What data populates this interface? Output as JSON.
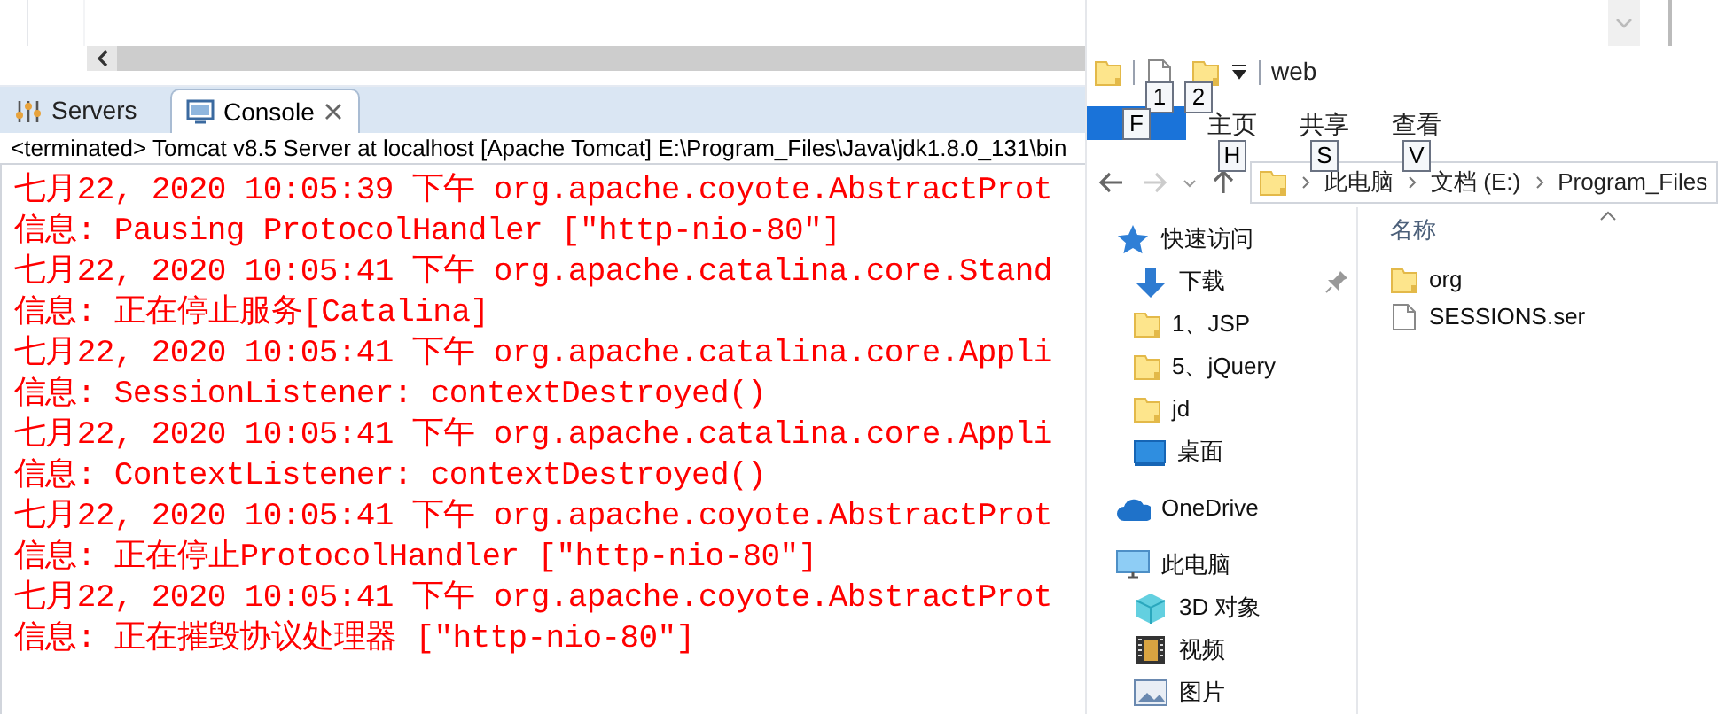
{
  "console_view": {
    "tabs": [
      {
        "label": "Servers",
        "kind": "servers",
        "selected": false
      },
      {
        "label": "Console",
        "kind": "console",
        "selected": true
      }
    ],
    "status": "<terminated> Tomcat v8.5 Server at localhost [Apache Tomcat] E:\\Program_Files\\Java\\jdk1.8.0_131\\bin",
    "lines": [
      "七月22, 2020 10:05:39 下午 org.apache.coyote.AbstractProt",
      "信息: Pausing ProtocolHandler [\"http-nio-80\"]",
      "七月22, 2020 10:05:41 下午 org.apache.catalina.core.Stand",
      "信息: 正在停止服务[Catalina]",
      "七月22, 2020 10:05:41 下午 org.apache.catalina.core.Appli",
      "信息: SessionListener: contextDestroyed()",
      "七月22, 2020 10:05:41 下午 org.apache.catalina.core.Appli",
      "信息: ContextListener: contextDestroyed()",
      "七月22, 2020 10:05:41 下午 org.apache.coyote.AbstractProt",
      "信息: 正在停止ProtocolHandler [\"http-nio-80\"]",
      "七月22, 2020 10:05:41 下午 org.apache.coyote.AbstractProt",
      "信息: 正在摧毁协议处理器 [\"http-nio-80\"]"
    ]
  },
  "explorer": {
    "title": "web",
    "quick_keytips": [
      "1",
      "2"
    ],
    "ribbon_tabs": [
      {
        "keytip": "F",
        "selected": true
      },
      {
        "label": "主页",
        "keytip": "H",
        "selected": false
      },
      {
        "label": "共享",
        "keytip": "S",
        "selected": false
      },
      {
        "label": "查看",
        "keytip": "V",
        "selected": false
      }
    ],
    "address": [
      "此电脑",
      "文档 (E:)",
      "Program_Files"
    ],
    "nav": [
      {
        "label": "快速访问",
        "kind": "star",
        "children": [
          {
            "label": "下载",
            "kind": "download",
            "pinned": true
          },
          {
            "label": "1、JSP",
            "kind": "folder",
            "pinned": false
          },
          {
            "label": "5、jQuery",
            "kind": "folder",
            "pinned": false
          },
          {
            "label": "jd",
            "kind": "folder",
            "pinned": false
          },
          {
            "label": "桌面",
            "kind": "desktop",
            "pinned": false
          }
        ]
      },
      {
        "label": "OneDrive",
        "kind": "cloud"
      },
      {
        "label": "此电脑",
        "kind": "pc",
        "children": [
          {
            "label": "3D 对象",
            "kind": "cube",
            "pinned": false
          },
          {
            "label": "视频",
            "kind": "film",
            "pinned": false
          },
          {
            "label": "图片",
            "kind": "image",
            "pinned": false
          }
        ]
      }
    ],
    "column": "名称",
    "files": [
      {
        "name": "org",
        "kind": "folder"
      },
      {
        "name": "SESSIONS.ser",
        "kind": "file"
      }
    ]
  }
}
